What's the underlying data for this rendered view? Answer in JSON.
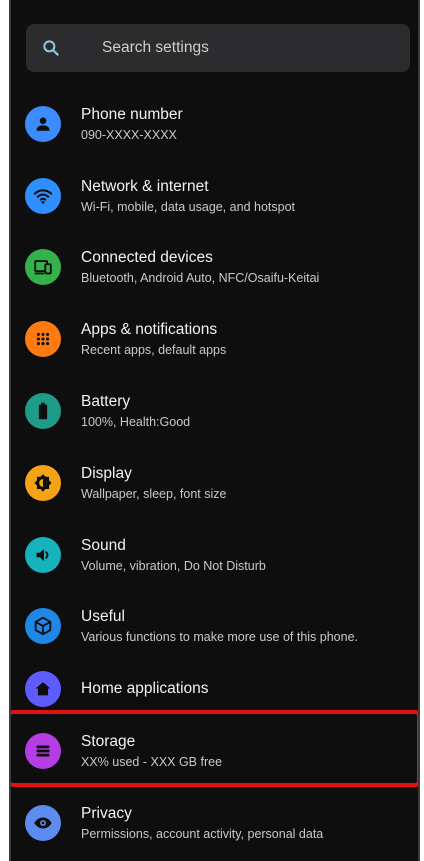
{
  "search": {
    "placeholder": "Search settings",
    "icon": "search-icon"
  },
  "settings": [
    {
      "title": "Phone number",
      "subtitle": "090-XXXX-XXXX",
      "icon": "person-icon",
      "color": "#3c8cff"
    },
    {
      "title": "Network & internet",
      "subtitle": "Wi-Fi, mobile, data usage, and hotspot",
      "icon": "wifi-icon",
      "color": "#2f8fff"
    },
    {
      "title": "Connected devices",
      "subtitle": "Bluetooth, Android Auto, NFC/Osaifu-Keitai",
      "icon": "devices-icon",
      "color": "#35b14b"
    },
    {
      "title": "Apps & notifications",
      "subtitle": "Recent apps, default apps",
      "icon": "apps-grid-icon",
      "color": "#ff7a10"
    },
    {
      "title": "Battery",
      "subtitle": "100%, Health:Good",
      "icon": "battery-icon",
      "color": "#1f9c88"
    },
    {
      "title": "Display",
      "subtitle": "Wallpaper, sleep, font size",
      "icon": "brightness-icon",
      "color": "#f5a316"
    },
    {
      "title": "Sound",
      "subtitle": "Volume, vibration, Do Not Disturb",
      "icon": "speaker-icon",
      "color": "#17b3bd"
    },
    {
      "title": "Useful",
      "subtitle": "Various functions to make more use of this phone.",
      "icon": "cube-icon",
      "color": "#1f87e6"
    },
    {
      "title": "Home applications",
      "subtitle": "",
      "icon": "home-icon",
      "color": "#5e5cff"
    },
    {
      "title": "Storage",
      "subtitle": "XX% used - XXX GB free",
      "icon": "storage-icon",
      "color": "#b53de6"
    },
    {
      "title": "Privacy",
      "subtitle": "Permissions, account activity, personal data",
      "icon": "privacy-eye-icon",
      "color": "#5d8bf0"
    }
  ],
  "highlight_color": "#e41010"
}
